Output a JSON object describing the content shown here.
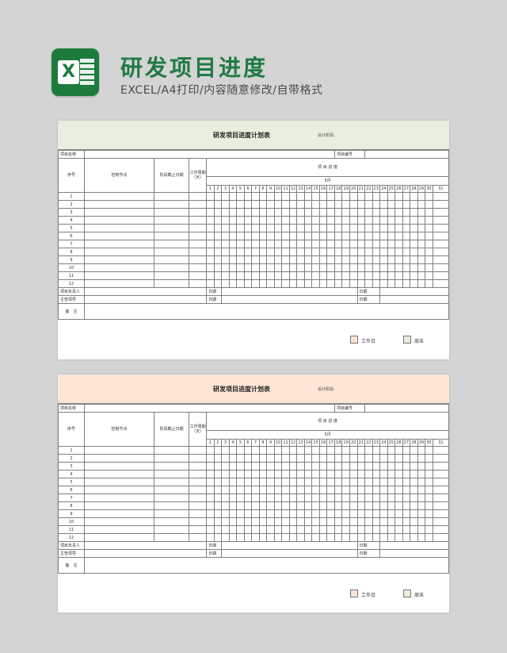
{
  "header": {
    "title": "研发项目进度",
    "subtitle": "EXCEL/A4打印/内容随意修改/自带格式",
    "icon": "excel-icon",
    "icon_letter": "X"
  },
  "colors": {
    "brand_green": "#1e7b3e",
    "sheet1_header_bg": "#e9efde",
    "sheet2_header_bg": "#fde5d6",
    "workday_swatch": "#fbe3d4",
    "weekend_swatch": "#e7eddc"
  },
  "sheets": [
    {
      "title": "研发项目进度计划表",
      "designer_label": "设计阶段:",
      "project_name_label": "项目名称",
      "project_no_label": "项目编号",
      "col_seq": "序号",
      "col_node": "控制节点",
      "col_deadline": "阶段截止日期",
      "col_cycle": "工作周期（天）",
      "progress_label": "项 目 进 度",
      "month": "5月",
      "days": [
        "1",
        "2",
        "3",
        "4",
        "5",
        "6",
        "7",
        "8",
        "9",
        "10",
        "11",
        "12",
        "13",
        "14",
        "15",
        "16",
        "17",
        "18",
        "19",
        "20",
        "21",
        "22",
        "23",
        "24",
        "25",
        "26",
        "27",
        "28",
        "29",
        "30",
        "31"
      ],
      "rows": [
        "1",
        "2",
        "3",
        "4",
        "5",
        "6",
        "7",
        "8",
        "9",
        "10",
        "11",
        "12"
      ],
      "owner_label": "项目负责人",
      "manager_label": "主管领导",
      "date_label": "日期",
      "remark_label": "备　注",
      "legend_workday": "工作日",
      "legend_weekend": "周末"
    },
    {
      "title": "研发项目进度计划表",
      "designer_label": "设计阶段:",
      "project_name_label": "项目名称",
      "project_no_label": "项目编号",
      "col_seq": "序号",
      "col_node": "控制节点",
      "col_deadline": "阶段截止日期",
      "col_cycle": "工作周期（天）",
      "progress_label": "项 目 进 度",
      "month": "5月",
      "days": [
        "1",
        "2",
        "3",
        "4",
        "5",
        "6",
        "7",
        "8",
        "9",
        "10",
        "11",
        "12",
        "13",
        "14",
        "15",
        "16",
        "17",
        "18",
        "19",
        "20",
        "21",
        "22",
        "23",
        "24",
        "25",
        "26",
        "27",
        "28",
        "29",
        "30",
        "31"
      ],
      "rows": [
        "1",
        "2",
        "3",
        "4",
        "5",
        "6",
        "7",
        "8",
        "9",
        "10",
        "11",
        "12"
      ],
      "owner_label": "项目负责人",
      "manager_label": "主管领导",
      "date_label": "日期",
      "remark_label": "备　注",
      "legend_workday": "工作日",
      "legend_weekend": "周末"
    }
  ]
}
